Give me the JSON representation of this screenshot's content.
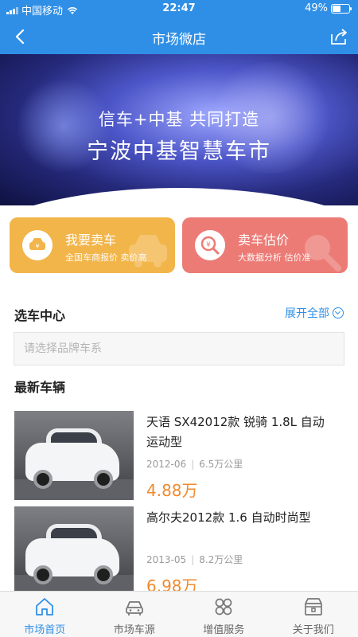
{
  "status_bar": {
    "carrier": "中国移动",
    "time": "22:47",
    "battery": "49%"
  },
  "nav": {
    "title": "市场微店"
  },
  "banner": {
    "line1": "信车+中基 共同打造",
    "line2": "宁波中基智慧车市"
  },
  "actions": [
    {
      "title": "我要卖车",
      "subtitle": "全国车商报价 卖价高",
      "color": "#f2b54a"
    },
    {
      "title": "卖车估价",
      "subtitle": "大数据分析 估价准",
      "color": "#ec7b76"
    }
  ],
  "select_car": {
    "title": "选车中心",
    "expand_label": "展开全部",
    "search_placeholder": "请选择品牌车系"
  },
  "latest": {
    "title": "最新车辆",
    "cars": [
      {
        "name": "天语 SX42012款 锐骑 1.8L 自动运动型",
        "year": "2012-06",
        "mileage": "6.5万公里",
        "price": "4.88万"
      },
      {
        "name": "高尔夫2012款 1.6 自动时尚型",
        "year": "2013-05",
        "mileage": "8.2万公里",
        "price": "6.98万"
      }
    ]
  },
  "tabs": [
    {
      "label": "市场首页",
      "icon": "home-icon",
      "active": true
    },
    {
      "label": "市场车源",
      "icon": "car-icon",
      "active": false
    },
    {
      "label": "增值服务",
      "icon": "grid-icon",
      "active": false
    },
    {
      "label": "关于我们",
      "icon": "store-icon",
      "active": false
    }
  ],
  "colors": {
    "primary": "#2f8fe6",
    "price": "#f08a2e"
  }
}
